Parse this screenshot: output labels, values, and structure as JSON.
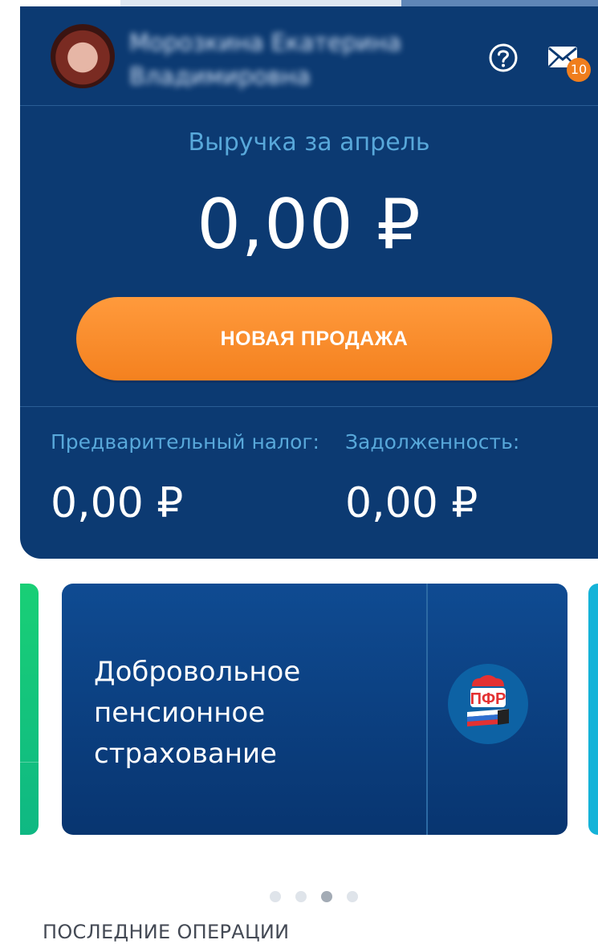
{
  "header": {
    "user_name_line1": "Морозкина Екатерина",
    "user_name_line2": "Владимировна",
    "help_icon": "question-circle-icon",
    "mail_icon": "envelope-icon",
    "mail_badge": "10"
  },
  "revenue": {
    "label": "Выручка за апрель",
    "amount": "0,00 ₽"
  },
  "new_sale_button": "НОВАЯ ПРОДАЖА",
  "stats": {
    "tax_label": "Предварительный налог:",
    "tax_value": "0,00 ₽",
    "debt_label": "Задолженность:",
    "debt_value": "0,00 ₽"
  },
  "carousel": {
    "card_title_lines": [
      "Добровольное",
      "пенсионное",
      "страхование"
    ],
    "card_logo": "pfr-logo-icon",
    "active_dot": 3,
    "dot_count": 4
  },
  "recent_operations_title": "ПОСЛЕДНИЕ ОПЕРАЦИИ",
  "colors": {
    "panel": "#0c3a72",
    "accent_orange": "#f4811f",
    "label_blue": "#58a8da",
    "badge": "#f07e1d"
  }
}
